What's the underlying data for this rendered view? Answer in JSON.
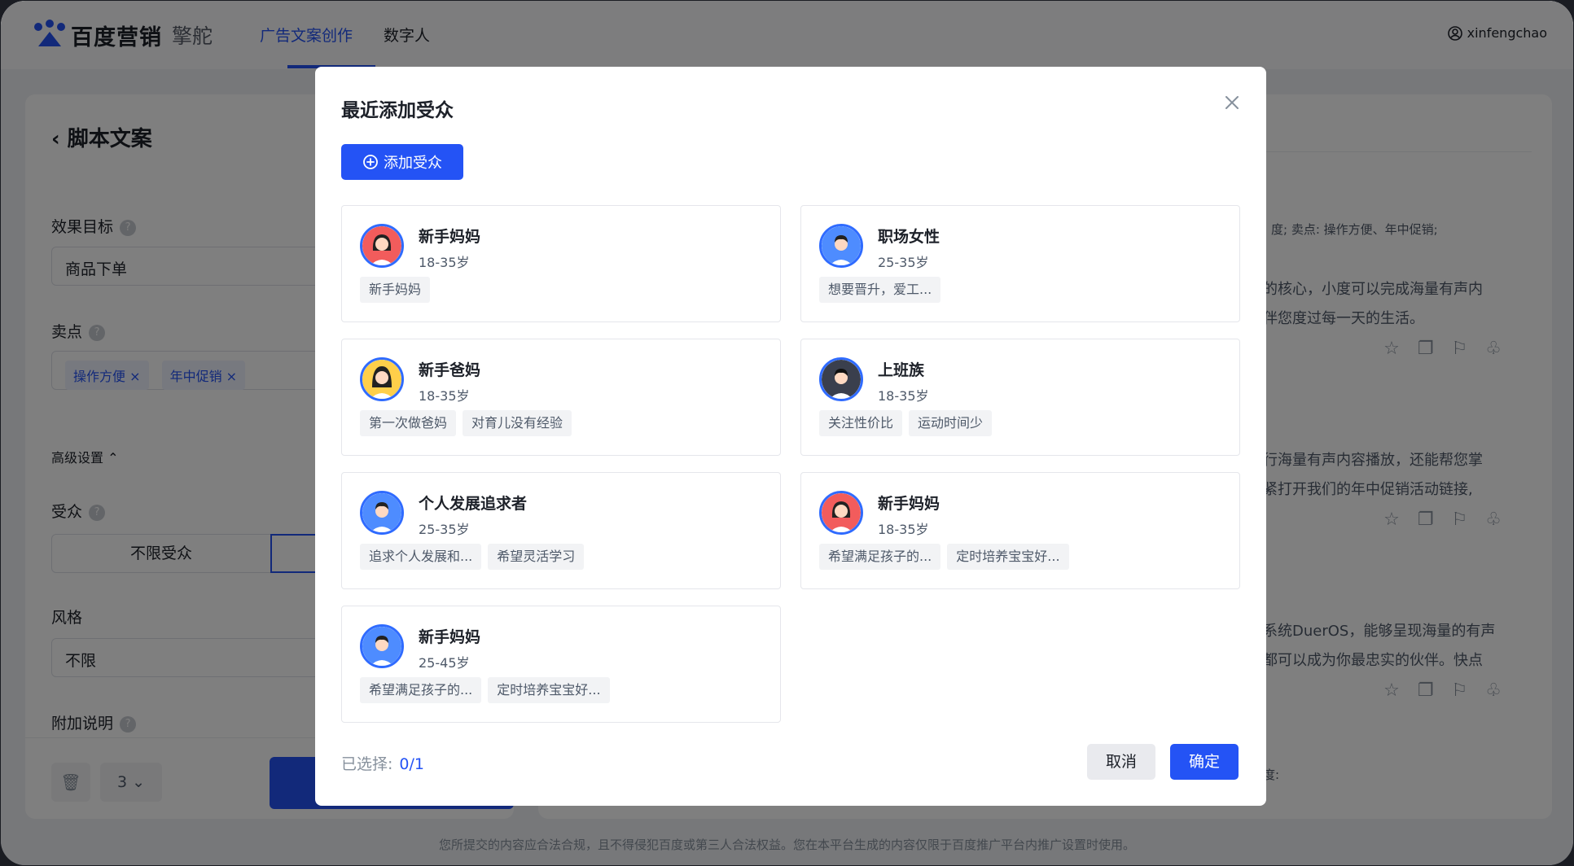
{
  "app": {
    "brand": "百度营销",
    "product": "擎舵",
    "nav": [
      "广告文案创作",
      "数字人"
    ],
    "user": "xinfengchao"
  },
  "left": {
    "title": "脚本文案",
    "goal_label": "效果目标",
    "goal_value": "商品下单",
    "selling_label": "卖点",
    "selling_chips": [
      "操作方便",
      "年中促销"
    ],
    "advanced": "高级设置",
    "audience_label": "受众",
    "audience_option": "不限受众",
    "style_label": "风格",
    "style_value": "不限",
    "extra_label": "附加说明",
    "count": "3"
  },
  "right": {
    "header_fragment": "度;  卖点:  操作方便、年中促销;",
    "para1": [
      "的核心，小度可以完成海量有声内",
      "伴您度过每一天的生活。"
    ],
    "para2": [
      "行海量有声内容播放，还能帮您掌",
      "紧打开我们的年中促销活动链接,"
    ],
    "para3": [
      "系统DuerOS，能够呈现海量的有声",
      "都可以成为你最忠实的伙伴。快点"
    ],
    "bottom_fragment": "度:"
  },
  "footer": "您所提交的内容应合法合规，且不得侵犯百度或第三人合法权益。您在本平台生成的内容仅限于百度推广平台内推广设置时使用。",
  "modal": {
    "title": "最近添加受众",
    "add_button": "添加受众",
    "audiences": [
      {
        "name": "新手妈妈",
        "age": "18-35岁",
        "tags": [
          "新手妈妈"
        ],
        "avatar": "woman-red"
      },
      {
        "name": "职场女性",
        "age": "25-35岁",
        "tags": [
          "想要晋升，爱工..."
        ],
        "avatar": "man-blue"
      },
      {
        "name": "新手爸妈",
        "age": "18-35岁",
        "tags": [
          "第一次做爸妈",
          "对育儿没有经验"
        ],
        "avatar": "woman-yellow"
      },
      {
        "name": "上班族",
        "age": "18-35岁",
        "tags": [
          "关注性价比",
          "运动时间少"
        ],
        "avatar": "man-dark"
      },
      {
        "name": "个人发展追求者",
        "age": "25-35岁",
        "tags": [
          "追求个人发展和...",
          "希望灵活学习"
        ],
        "avatar": "man-blue"
      },
      {
        "name": "新手妈妈",
        "age": "18-35岁",
        "tags": [
          "希望满足孩子的...",
          "定时培养宝宝好..."
        ],
        "avatar": "woman-red"
      },
      {
        "name": "新手妈妈",
        "age": "25-45岁",
        "tags": [
          "希望满足孩子的...",
          "定时培养宝宝好..."
        ],
        "avatar": "man-blue"
      }
    ],
    "selected_label": "已选择:",
    "selected_count": "0/1",
    "cancel": "取消",
    "confirm": "确定"
  }
}
